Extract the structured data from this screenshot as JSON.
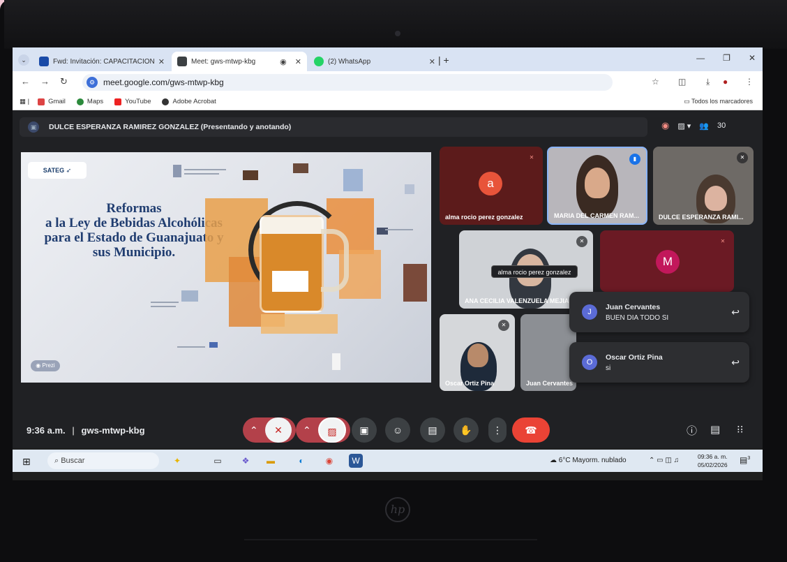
{
  "browser": {
    "tabs": [
      {
        "label": "Fwd: Invitación: CAPACITACION"
      },
      {
        "label": "Meet: gws-mtwp-kbg"
      },
      {
        "label": "(2) WhatsApp"
      }
    ],
    "url": "meet.google.com/gws-mtwp-kbg",
    "bookmarks": [
      {
        "label": "Gmail"
      },
      {
        "label": "Maps"
      },
      {
        "label": "YouTube"
      },
      {
        "label": "Adobe Acrobat"
      }
    ],
    "all_bookmarks": "Todos los marcadores"
  },
  "meet": {
    "presenter_banner": "DULCE ESPERANZA RAMIREZ GONZALEZ (Presentando y anotando)",
    "participant_count": "30",
    "meeting_time": "9:36 a.m.",
    "meeting_code": "gws-mtwp-kbg",
    "slide": {
      "badge": "SATEG",
      "title_lines": [
        "Reformas",
        "a la Ley de Bebidas Alcohólicas",
        "para el Estado de Guanajuato y",
        "sus Municipio."
      ],
      "prezi_label": "Prezi"
    },
    "participants": [
      {
        "name": "alma rocio perez gonzalez",
        "initial": "a",
        "color": "#e8543a"
      },
      {
        "name": "MARIA DEL CARMEN RAM...",
        "initial": "",
        "color": ""
      },
      {
        "name": "DULCE ESPERANZA RAMI...",
        "initial": "",
        "color": ""
      },
      {
        "name": "ANA CECILIA VALENZUELA MEJIA",
        "initial": "",
        "color": ""
      },
      {
        "name": "",
        "initial": "M",
        "color": "#c2185b"
      },
      {
        "name": "Oscar Ortiz Pina",
        "initial": "",
        "color": ""
      },
      {
        "name": "Juan Cervantes",
        "initial": "",
        "color": ""
      }
    ],
    "tooltip": "alma rocio perez gonzalez",
    "chat_toasts": [
      {
        "sender": "Juan Cervantes",
        "initial": "J",
        "message": "BUEN DIA TODO SI"
      },
      {
        "sender": "Oscar Ortiz Pina",
        "initial": "O",
        "message": "si"
      }
    ]
  },
  "taskbar": {
    "search_placeholder": "Buscar",
    "weather": "6°C  Mayorm. nublado",
    "time": "09:36 a. m.",
    "date": "05/02/2026",
    "notification_count": "3"
  },
  "colors": {
    "meet_bg": "#202124",
    "hangup": "#ea4335",
    "muted_red": "#b3414a",
    "slide_title": "#203d70"
  }
}
